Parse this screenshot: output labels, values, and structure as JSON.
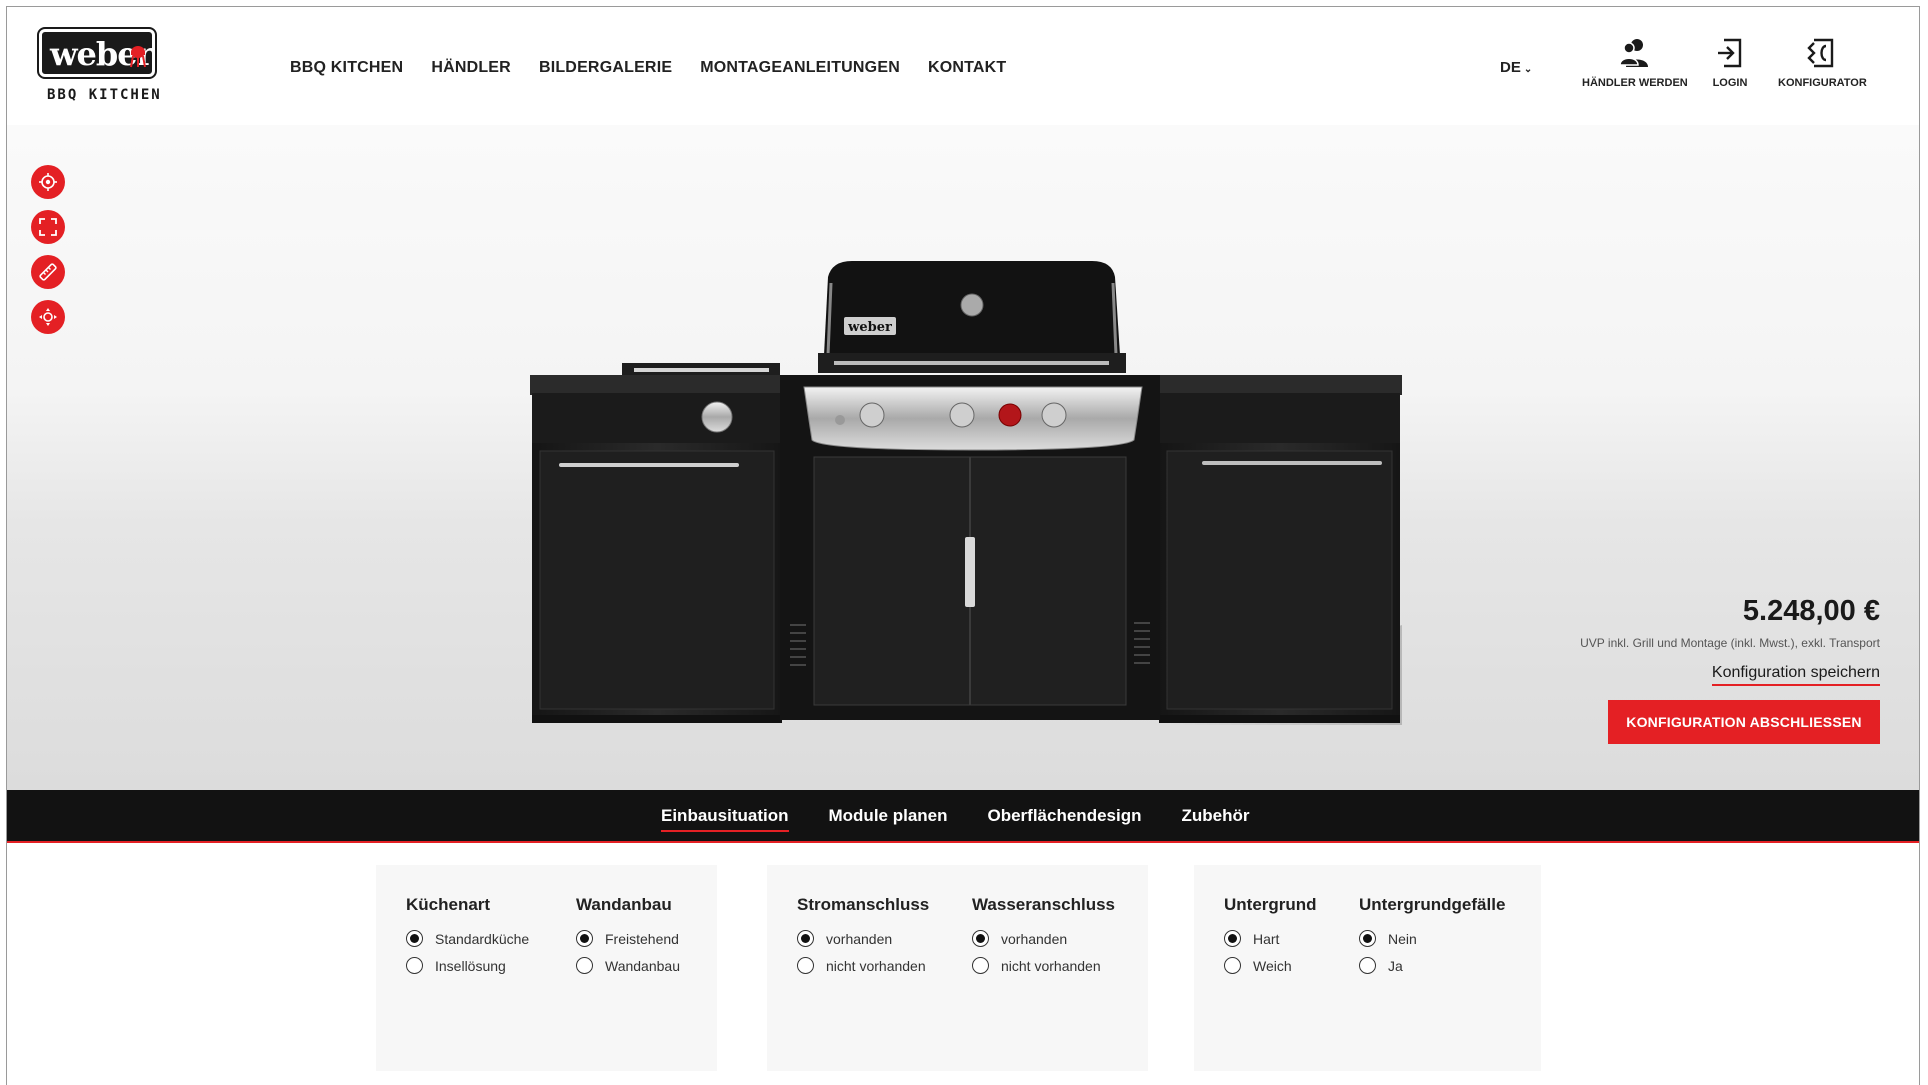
{
  "brand": {
    "logo_word": "weber",
    "logo_sub": "BBQ KITCHEN",
    "accent": "#e42024"
  },
  "nav": [
    "BBQ KITCHEN",
    "HÄNDLER",
    "BILDERGALERIE",
    "MONTAGEANLEITUNGEN",
    "KONTAKT"
  ],
  "lang": "DE",
  "header_actions": [
    {
      "label": "HÄNDLER WERDEN",
      "icon": "users-icon"
    },
    {
      "label": "LOGIN",
      "icon": "login-icon"
    },
    {
      "label": "KONFIGURATOR",
      "icon": "configurator-icon"
    }
  ],
  "tools": [
    "target-icon",
    "fullscreen-icon",
    "ruler-icon",
    "move-icon"
  ],
  "product": {
    "grill_badge": "weber"
  },
  "pricing": {
    "price": "5.248,00 €",
    "note": "UVP inkl. Grill und Montage (inkl. Mwst.), exkl. Transport",
    "save": "Konfiguration speichern",
    "finish": "KONFIGURATION ABSCHLIESSEN"
  },
  "tabs": [
    {
      "label": "Einbausituation",
      "active": true
    },
    {
      "label": "Module planen",
      "active": false
    },
    {
      "label": "Oberflächendesign",
      "active": false
    },
    {
      "label": "Zubehör",
      "active": false
    }
  ],
  "panels": [
    {
      "groups": [
        {
          "title": "Küchenart",
          "options": [
            {
              "label": "Standardküche",
              "checked": true
            },
            {
              "label": "Insellösung",
              "checked": false
            }
          ]
        },
        {
          "title": "Wandanbau",
          "options": [
            {
              "label": "Freistehend",
              "checked": true
            },
            {
              "label": "Wandanbau",
              "checked": false
            }
          ]
        }
      ]
    },
    {
      "groups": [
        {
          "title": "Stromanschluss",
          "options": [
            {
              "label": "vorhanden",
              "checked": true
            },
            {
              "label": "nicht vorhanden",
              "checked": false
            }
          ]
        },
        {
          "title": "Wasseranschluss",
          "options": [
            {
              "label": "vorhanden",
              "checked": true
            },
            {
              "label": "nicht vorhanden",
              "checked": false
            }
          ]
        }
      ]
    },
    {
      "groups": [
        {
          "title": "Untergrund",
          "options": [
            {
              "label": "Hart",
              "checked": true
            },
            {
              "label": "Weich",
              "checked": false
            }
          ]
        },
        {
          "title": "Untergrundgefälle",
          "options": [
            {
              "label": "Nein",
              "checked": true
            },
            {
              "label": "Ja",
              "checked": false
            }
          ]
        }
      ]
    }
  ]
}
